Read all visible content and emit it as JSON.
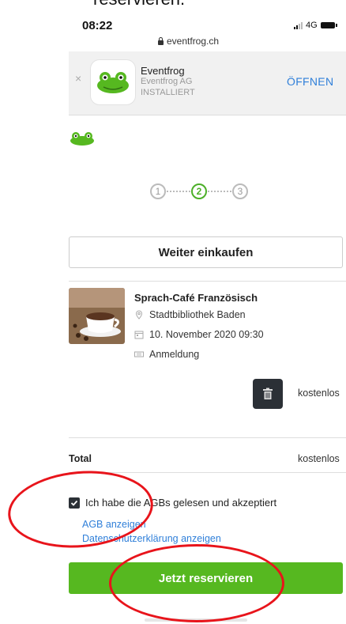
{
  "caption": {
    "text": "reservieren."
  },
  "status_bar": {
    "time": "08:22",
    "network": "4G"
  },
  "browser": {
    "url": "eventfrog.ch"
  },
  "app_banner": {
    "close": "×",
    "app_name": "Eventfrog",
    "company": "Eventfrog AG",
    "status": "INSTALLIERT",
    "open_label": "ÖFFNEN"
  },
  "steps": {
    "items": [
      "1",
      "2",
      "3"
    ],
    "active_index": 1
  },
  "continue_button": {
    "label": "Weiter einkaufen"
  },
  "event": {
    "title": "Sprach-Café Französisch",
    "location": "Stadtbibliothek Baden",
    "datetime": "10. November 2020 09:30",
    "ticket_type": "Anmeldung",
    "price": "kostenlos"
  },
  "total": {
    "label": "Total",
    "value": "kostenlos"
  },
  "terms": {
    "checked": true,
    "label": "Ich habe die AGBs gelesen und akzeptiert",
    "agb_link": "AGB anzeigen",
    "privacy_link": "Datenschutzerklärung anzeigen"
  },
  "reserve_button": {
    "label": "Jetzt reservieren"
  },
  "colors": {
    "brand_green": "#56b820",
    "link_blue": "#2f7fd9",
    "annotation_red": "#e8141b",
    "dark": "#2b3036"
  }
}
